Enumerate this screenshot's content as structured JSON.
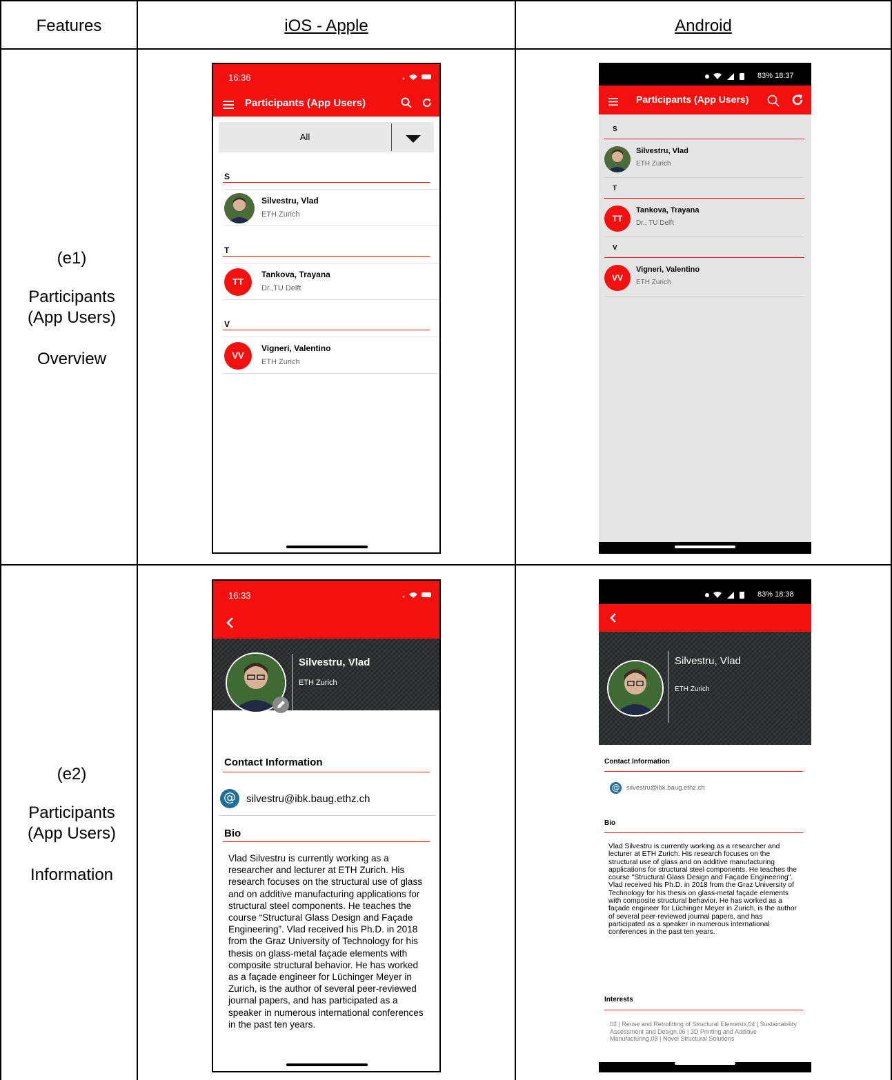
{
  "table": {
    "header_features": "Features",
    "header_ios": "iOS - Apple",
    "header_android": "Android",
    "row1": {
      "code": "(e1)",
      "line1": "Participants",
      "line2": "(App Users)",
      "line3": "Overview"
    },
    "row2": {
      "code": "(e2)",
      "line1": "Participants",
      "line2": "(App Users)",
      "line3": "Information"
    }
  },
  "colors": {
    "accent": "#f51010",
    "hero": "#2f3133",
    "email_icon": "#1f6e9c"
  },
  "icons": [
    "hamburger-menu-icon",
    "search-icon",
    "refresh-icon",
    "chevron-down-icon",
    "back-icon",
    "email-at-icon",
    "edit-pencil-icon",
    "wifi-icon",
    "battery-icon"
  ],
  "ios_overview": {
    "time": "16:36",
    "title": "Participants (App Users)",
    "filter": "All",
    "sections": [
      {
        "letter": "S",
        "name": "Silvestru, Vlad",
        "affiliation": "ETH Zurich"
      },
      {
        "letter": "T",
        "name": "Tankova, Trayana",
        "affiliation": "Dr.,TU Delft",
        "initials": "TT"
      },
      {
        "letter": "V",
        "name": "Vigneri, Valentino",
        "affiliation": "ETH Zurich",
        "initials": "VV"
      }
    ]
  },
  "android_overview": {
    "status": "83% 18:37",
    "title": "Participants (App Users)",
    "sections": [
      {
        "letter": "S",
        "name": "Silvestru, Vlad",
        "affiliation": "ETH Zurich"
      },
      {
        "letter": "T",
        "name": "Tankova, Trayana",
        "affiliation": "Dr., TU Delft",
        "initials": "TT"
      },
      {
        "letter": "V",
        "name": "Vigneri, Valentino",
        "affiliation": "ETH Zurich",
        "initials": "VV"
      }
    ]
  },
  "ios_detail": {
    "time": "16:33",
    "name": "Silvestru, Vlad",
    "affiliation": "ETH Zurich",
    "contact_heading": "Contact Information",
    "email": "silvestru@ibk.baug.ethz.ch",
    "bio_heading": "Bio",
    "bio": "Vlad Silvestru is currently working as a researcher and lecturer at ETH Zurich. His research focuses on the structural use of glass and on additive manufacturing applications for structural steel components. He teaches the course “Structural Glass Design and Façade Engineering”. Vlad received his Ph.D. in 2018 from the Graz University of Technology for his thesis on glass-metal façade elements with composite structural behavior. He has worked as a façade engineer for Lüchinger Meyer in Zurich, is the author of several peer-reviewed journal papers, and has participated as a speaker in numerous international conferences in the past ten years."
  },
  "android_detail": {
    "status": "83% 18:38",
    "name": "Silvestru, Vlad",
    "affiliation": "ETH Zurich",
    "contact_heading": "Contact Information",
    "email": "silvestru@ibk.baug.ethz.ch",
    "bio_heading": "Bio",
    "bio": "Vlad Silvestru is currently working as a researcher and lecturer at ETH Zurich. His research focuses on the structural use of glass and on additive manufacturing applications for structural steel components. He teaches the course \"Structural Glass Design and Façade Engineering\". Vlad received his Ph.D. in 2018 from the Graz University of Technology for his thesis on glass-metal façade elements with composite structural behavior. He has worked as a façade engineer for Lüchinger Meyer in Zurich, is the author of several peer-reviewed journal papers, and has participated as a speaker in numerous international conferences in the past ten years.",
    "interests_heading": "Interests",
    "interests": "02 | Reuse and Retrofitting of Structural Elements,04 | Sustainability Assessment and Design,06 | 3D Printing and Additive Manufacturing,08 | Novel Structural Solutions"
  }
}
